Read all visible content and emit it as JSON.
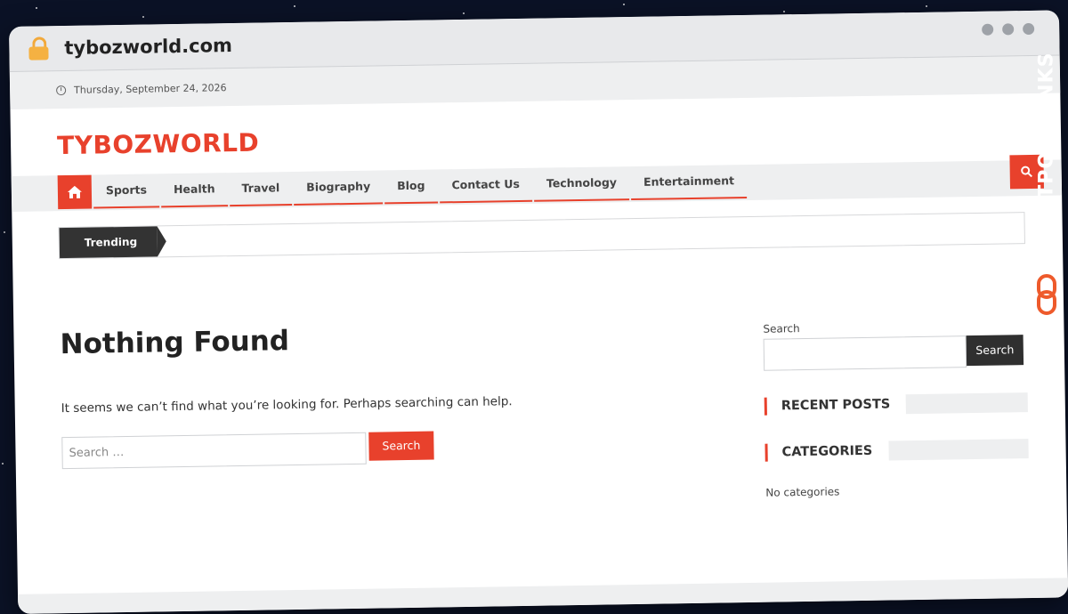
{
  "browser": {
    "url": "tybozworld.com"
  },
  "topbar": {
    "date": "Thursday, September 24, 2026"
  },
  "site": {
    "logo": "TYBOZWORLD"
  },
  "nav": {
    "items": [
      "Sports",
      "Health",
      "Travel",
      "Biography",
      "Blog",
      "Contact Us",
      "Technology",
      "Entertainment"
    ]
  },
  "ticker": {
    "label": "Trending"
  },
  "main": {
    "title": "Nothing Found",
    "message": "It seems we can’t find what you’re looking for. Perhaps searching can help.",
    "search_placeholder": "Search …",
    "search_button": "Search"
  },
  "sidebar": {
    "search_label": "Search",
    "search_button": "Search",
    "recent_posts_title": "RECENT POSTS",
    "categories_title": "CATEGORIES",
    "categories_empty": "No categories"
  },
  "watermark": {
    "text": "GUESTPOSTLINKS"
  },
  "colors": {
    "accent": "#e8412c",
    "dark": "#333333",
    "background": "#0b1226"
  }
}
